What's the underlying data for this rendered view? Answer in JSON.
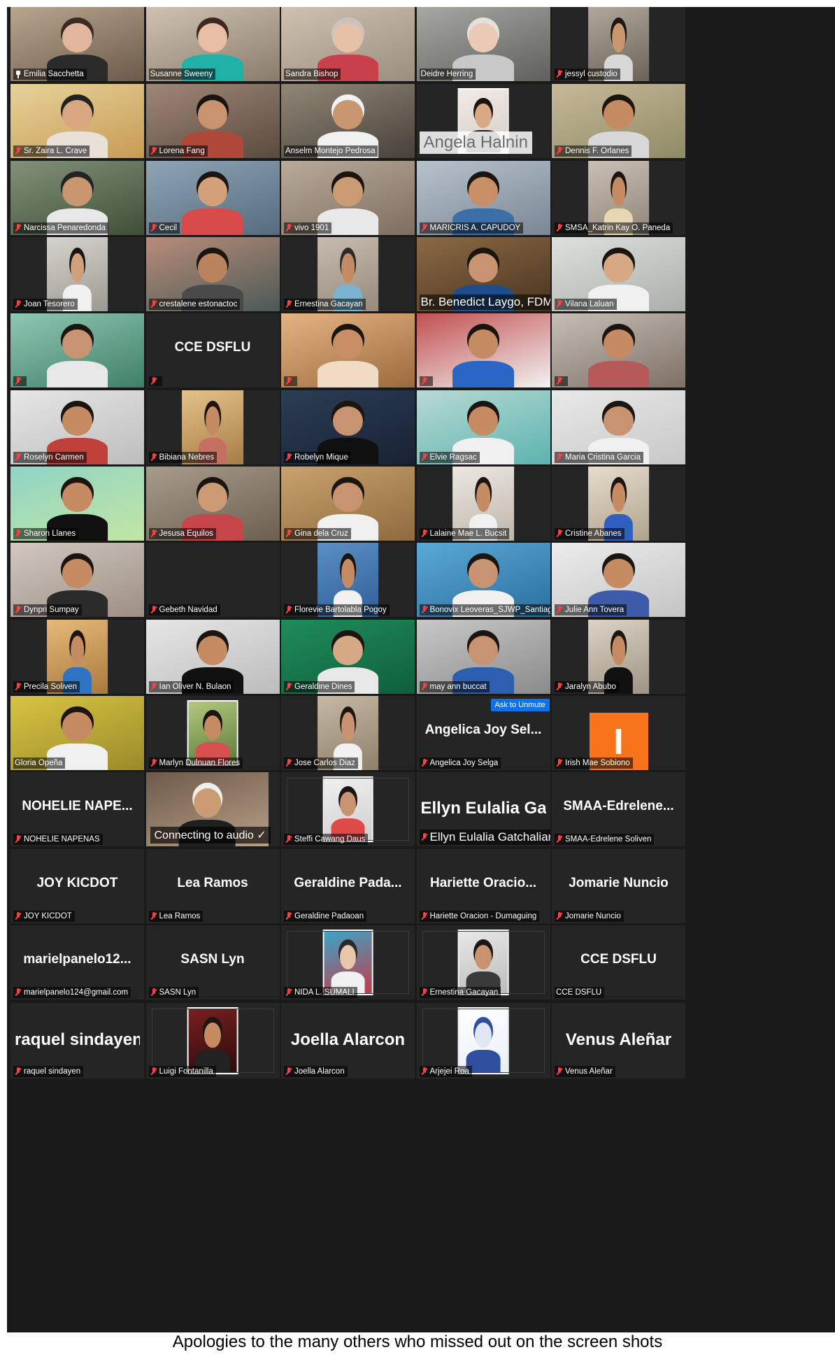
{
  "meeting": {
    "tiles": [
      {
        "name": "Emilia Sacchetta",
        "icon": "pin-icon",
        "muted": false,
        "type": "video",
        "bg": [
          "#b9a68f",
          "#6c5a4a"
        ],
        "skin": "#e1b69c",
        "hair": "#3a2a22",
        "shirt": "#2a2a2a"
      },
      {
        "name": "Susanne Sweeny",
        "muted": false,
        "active": true,
        "type": "video",
        "bg": [
          "#cfc2b0",
          "#8a7c6a"
        ],
        "skin": "#e7bda5",
        "hair": "#3c2a20",
        "shirt": "#1fb0a8"
      },
      {
        "name": "Sandra Bishop",
        "muted": false,
        "type": "video",
        "bg": [
          "#cfc1b0",
          "#9c8e7e"
        ],
        "skin": "#e7c0a8",
        "hair": "#c9c5bd",
        "shirt": "#c8404a"
      },
      {
        "name": "Deidre Herring",
        "muted": false,
        "type": "video",
        "bg": [
          "#a8a8a2",
          "#60605a"
        ],
        "skin": "#ecc9b4",
        "hair": "#e4e1da",
        "shirt": "#c8c8c8"
      },
      {
        "name": "jessyl custodio",
        "muted": true,
        "type": "video",
        "narrow": true,
        "bg": [
          "#b0a89a",
          "#6b6358"
        ],
        "skin": "#c9966e",
        "hair": "#1e1612",
        "shirt": "#d8d8d8"
      },
      {
        "name": "Sr. Zaira L. Crave",
        "muted": true,
        "type": "video",
        "bg": [
          "#e6d29a",
          "#c89b54"
        ],
        "skin": "#d9a67f",
        "hair": "#222222",
        "shirt": "#e9e1d8"
      },
      {
        "name": "Lorena Fang",
        "muted": true,
        "type": "video",
        "bg": [
          "#9f8777",
          "#5a4a3f"
        ],
        "skin": "#c99370",
        "hair": "#1a1410",
        "shirt": "#b0483a"
      },
      {
        "name": "Anselm Montejo Pedrosa",
        "muted": false,
        "type": "video",
        "bg": [
          "#928777",
          "#48413a"
        ],
        "skin": "#c9976f",
        "hair": "#f2f2f2",
        "shirt": "#f0f0f0"
      },
      {
        "name": "Angela Halnin",
        "muted": false,
        "type": "photo",
        "bg": [
          "#f1ebe6",
          "#d6ccc6"
        ],
        "skin": "#d8a985",
        "hair": "#1b1411",
        "shirt": "#1d1d1d"
      },
      {
        "name": "Dennis F. Orlanes",
        "muted": true,
        "type": "video",
        "bg": [
          "#c7b999",
          "#8f8a66"
        ],
        "skin": "#c58c63",
        "hair": "#1b1411",
        "shirt": "#d8d8d8"
      },
      {
        "name": "Narcissa Penaredonda",
        "muted": true,
        "type": "video",
        "bg": [
          "#83917a",
          "#3e4f38"
        ],
        "skin": "#c9976f",
        "hair": "#232323",
        "shirt": "#e8e8e8"
      },
      {
        "name": "Cecil",
        "muted": true,
        "type": "video",
        "bg": [
          "#8fa5b5",
          "#556c7c"
        ],
        "skin": "#d4a07a",
        "hair": "#1b1411",
        "shirt": "#d94a4a"
      },
      {
        "name": "vivo 1901",
        "muted": true,
        "type": "video",
        "bg": [
          "#b9ab9a",
          "#7d6e5e"
        ],
        "skin": "#cb9b74",
        "hair": "#1b1411",
        "shirt": "#e8e8e8"
      },
      {
        "name": "MARICRIS A. CAPUDOY",
        "muted": true,
        "type": "video",
        "bg": [
          "#b7c2cc",
          "#7a8794"
        ],
        "skin": "#c88e65",
        "hair": "#1b1411",
        "shirt": "#3c6fa8"
      },
      {
        "name": "SMSA_Katrin Kay O. Paneda",
        "muted": true,
        "type": "video",
        "narrow": true,
        "bg": [
          "#c9bfb2",
          "#90857a"
        ],
        "skin": "#c58c63",
        "hair": "#1b1411",
        "shirt": "#e8d7b3"
      },
      {
        "name": "Joan Tesorero",
        "muted": true,
        "type": "video",
        "narrow": true,
        "bg": [
          "#d6d3cd",
          "#9d9a95"
        ],
        "skin": "#d0a07c",
        "hair": "#1b1411",
        "shirt": "#f0f0f0"
      },
      {
        "name": "crestalene estonactoc",
        "muted": true,
        "type": "video",
        "bg": [
          "#b98c7a",
          "#4b5a56"
        ],
        "skin": "#b9845d",
        "hair": "#1b1411",
        "shirt": "#4a4a4a"
      },
      {
        "name": "Ernestina Gacayan",
        "muted": true,
        "type": "video",
        "narrow": true,
        "bg": [
          "#c7bcae",
          "#958a7c"
        ],
        "skin": "#c58c63",
        "hair": "#2b2b2b",
        "shirt": "#7bb3cf"
      },
      {
        "name": "Br. Benedict Laygo, FDM",
        "muted": false,
        "big_label": true,
        "type": "video",
        "bg": [
          "#8b6a44",
          "#4a3421"
        ],
        "skin": "#c89370",
        "hair": "#1b1411",
        "shirt": "#1f4c8a"
      },
      {
        "name": "Vilana Laluan",
        "muted": true,
        "type": "video",
        "bg": [
          "#dee0dd",
          "#a9b0a8"
        ],
        "skin": "#d6a883",
        "hair": "#1b1411",
        "shirt": "#f0f0f0"
      },
      {
        "name": "",
        "muted": true,
        "type": "video",
        "bg": [
          "#8fc8b4",
          "#3f7f68"
        ],
        "skin": "#c89370",
        "hair": "#1b1411",
        "shirt": "#e7e7e7"
      },
      {
        "name": "",
        "muted": true,
        "type": "text",
        "big": "CCE DSFLU"
      },
      {
        "name": "",
        "muted": true,
        "type": "video",
        "bg": [
          "#e6b482",
          "#9b6b3c"
        ],
        "skin": "#c88e65",
        "hair": "#1b1411",
        "shirt": "#f0dcc4"
      },
      {
        "name": "",
        "muted": true,
        "type": "video",
        "bg": [
          "#c24f4f",
          "#f2f2f2"
        ],
        "skin": "#c58c63",
        "hair": "#1b1411",
        "shirt": "#2a66c4"
      },
      {
        "name": "",
        "muted": true,
        "type": "video",
        "bg": [
          "#c6beb6",
          "#7e7066"
        ],
        "skin": "#c58c63",
        "hair": "#1b1411",
        "shirt": "#b55a59"
      },
      {
        "name": "Roselyn Carmen",
        "muted": true,
        "type": "video",
        "bg": [
          "#e6e6e6",
          "#bdbdbd"
        ],
        "skin": "#c58c63",
        "hair": "#1b1411",
        "shirt": "#c0403a"
      },
      {
        "name": "Bibiana Nebres",
        "muted": true,
        "type": "video",
        "narrow": true,
        "bg": [
          "#e4c28a",
          "#a77d44"
        ],
        "skin": "#c58c63",
        "hair": "#1b1411",
        "shirt": "#c56f62"
      },
      {
        "name": "Robelyn Mique",
        "muted": true,
        "type": "video",
        "bg": [
          "#2c3d55",
          "#182233"
        ],
        "skin": "#c89370",
        "hair": "#1b1411",
        "shirt": "#101010"
      },
      {
        "name": "Elvie Ragsac",
        "muted": true,
        "type": "video",
        "bg": [
          "#b9d9d3",
          "#5bb4b0"
        ],
        "skin": "#c58c63",
        "hair": "#1b1411",
        "shirt": "#f0f0f0"
      },
      {
        "name": "Maria Cristina Garcia",
        "muted": true,
        "type": "video",
        "bg": [
          "#e9e9e9",
          "#c7c7c7"
        ],
        "skin": "#c89370",
        "hair": "#1b1411",
        "shirt": "#f0f0f0"
      },
      {
        "name": "Sharon Llanes",
        "muted": true,
        "type": "video",
        "bg": [
          "#8fd4c6",
          "#c2e6a3"
        ],
        "skin": "#c58c63",
        "hair": "#1b1411",
        "shirt": "#101010"
      },
      {
        "name": "Jesusa Equilos",
        "muted": true,
        "type": "video",
        "bg": [
          "#a79b8c",
          "#6b604f"
        ],
        "skin": "#cb9b74",
        "hair": "#1b1411",
        "shirt": "#c64649"
      },
      {
        "name": "Gina dela Cruz",
        "muted": true,
        "type": "video",
        "bg": [
          "#c9a26d",
          "#8e6a3e"
        ],
        "skin": "#c89370",
        "hair": "#1b1411",
        "shirt": "#f0f0f0"
      },
      {
        "name": "Lalaine Mae L. Bucsit",
        "muted": true,
        "type": "video",
        "narrow": true,
        "bg": [
          "#ece8e1",
          "#bdb6ab"
        ],
        "skin": "#c58c63",
        "hair": "#1b1411",
        "shirt": "#f0f0f0"
      },
      {
        "name": "Cristine Abanes",
        "muted": true,
        "type": "video",
        "narrow": true,
        "bg": [
          "#e6dccb",
          "#b0a38d"
        ],
        "skin": "#c58c63",
        "hair": "#1b1411",
        "shirt": "#2f5fbf"
      },
      {
        "name": "Dynpri Sumpay",
        "muted": true,
        "type": "video",
        "bg": [
          "#d2c8bf",
          "#9c8f85"
        ],
        "skin": "#c58c63",
        "hair": "#1b1411",
        "shirt": "#2a2a2a"
      },
      {
        "name": "Gebeth Navidad",
        "muted": true,
        "type": "empty"
      },
      {
        "name": "Florevie Bartolabla Pogoy",
        "muted": true,
        "type": "video",
        "narrow": true,
        "bg": [
          "#5c8fc4",
          "#2e5e9a"
        ],
        "skin": "#c58c63",
        "hair": "#1b1411",
        "shirt": "#f0f0f0"
      },
      {
        "name": "Bonovix Leoveras_SJWP_Santiago...",
        "muted": true,
        "type": "video",
        "bg": [
          "#5aa9d6",
          "#2a6ea0"
        ],
        "skin": "#c89370",
        "hair": "#1b1411",
        "shirt": "#f0f0f0"
      },
      {
        "name": "Julie Ann Tovera",
        "muted": true,
        "type": "video",
        "bg": [
          "#ececec",
          "#c4c4c4"
        ],
        "skin": "#c58c63",
        "hair": "#1b1411",
        "shirt": "#3d5ba8"
      },
      {
        "name": "Precila Soliven",
        "muted": true,
        "type": "video",
        "narrow": true,
        "bg": [
          "#e6b97a",
          "#a87a3b"
        ],
        "skin": "#c58c63",
        "hair": "#1b1411",
        "shirt": "#2e73c4"
      },
      {
        "name": "Ian Oliver N. Bulaon",
        "muted": true,
        "type": "video",
        "bg": [
          "#e6e6e6",
          "#bcbcbc"
        ],
        "skin": "#c58c63",
        "hair": "#1b1411",
        "shirt": "#101010"
      },
      {
        "name": "Geraldine Dines",
        "muted": true,
        "type": "video",
        "bg": [
          "#1f8c5a",
          "#0f5f3c"
        ],
        "skin": "#d6a883",
        "hair": "#1b1411",
        "shirt": "#e8e8e8"
      },
      {
        "name": "may ann buccat",
        "muted": true,
        "type": "video",
        "bg": [
          "#c8c8c8",
          "#8a8a8a"
        ],
        "skin": "#c89370",
        "hair": "#1b1411",
        "shirt": "#2d5fb0"
      },
      {
        "name": "Jaralyn Abubo",
        "muted": true,
        "type": "video",
        "narrow": true,
        "bg": [
          "#dcd2c6",
          "#9f9383"
        ],
        "skin": "#c58c63",
        "hair": "#1b1411",
        "shirt": "#101010"
      },
      {
        "name": "Gloria Opeña",
        "muted": false,
        "type": "video",
        "bg": [
          "#d8c443",
          "#9a8b2a"
        ],
        "skin": "#c58c63",
        "hair": "#1b1411",
        "shirt": "#f0f0f0"
      },
      {
        "name": "Marlyn Dulnuan Flores",
        "muted": true,
        "type": "photo",
        "bg": [
          "#b3c97e",
          "#5b7a3a"
        ],
        "skin": "#c58c63",
        "hair": "#1b1411",
        "shirt": "#d84f4f"
      },
      {
        "name": "Jose Carlos Diaz",
        "muted": true,
        "type": "video",
        "narrow": true,
        "bg": [
          "#c6b9a3",
          "#8e806a"
        ],
        "skin": "#c89370",
        "hair": "#1b1411",
        "shirt": "#f0f0f0"
      },
      {
        "name": "Angelica Joy Selga",
        "muted": true,
        "type": "text",
        "big": "Angelica Joy Sel...",
        "overlay": {
          "unmute": "Ask to Unmute",
          "more": "···"
        }
      },
      {
        "name": "Irish Mae Sobiono",
        "muted": true,
        "type": "avatar",
        "letter": "I"
      },
      {
        "name": "NOHELIE NAPENAS",
        "muted": true,
        "type": "text",
        "big": "NOHELIE NAPE..."
      },
      {
        "name": "",
        "muted": false,
        "type": "connecting",
        "status": "Connecting to audio ✓",
        "bg": [
          "#6c5a4a",
          "#b89f86"
        ],
        "skin": "#cb9b74",
        "hair": "#eeeeee",
        "shirt": "#202020"
      },
      {
        "name": "Steffi Cawang Daus",
        "muted": true,
        "type": "photo",
        "bg": [
          "#f0f0f0",
          "#cfcfcf"
        ],
        "skin": "#c89370",
        "hair": "#1b1411",
        "shirt": "#e04a4a"
      },
      {
        "name": "Ellyn Eulalia Gatchalian",
        "muted": true,
        "big_label": true,
        "type": "text",
        "big": "Ellyn Eulalia Gat...",
        "lg": true
      },
      {
        "name": "SMAA-Edrelene Soliven",
        "muted": true,
        "type": "text",
        "big": "SMAA-Edrelene..."
      },
      {
        "name": "JOY KICDOT",
        "muted": true,
        "type": "text",
        "big": "JOY KICDOT"
      },
      {
        "name": "Lea Ramos",
        "muted": true,
        "type": "text",
        "big": "Lea Ramos"
      },
      {
        "name": "Geraldine Padaoan",
        "muted": true,
        "type": "text",
        "big": "Geraldine Pada..."
      },
      {
        "name": "Hariette Oracion - Dumaguing",
        "muted": true,
        "type": "text",
        "big": "Hariette Oracio..."
      },
      {
        "name": "Jomarie Nuncio",
        "muted": true,
        "type": "text",
        "big": "Jomarie Nuncio"
      },
      {
        "name": "marielpanelo124@gmail.com",
        "muted": true,
        "type": "text",
        "big": "marielpanelo12..."
      },
      {
        "name": "SASN Lyn",
        "muted": true,
        "type": "text",
        "big": "SASN Lyn"
      },
      {
        "name": "NIDA L. SUMALI",
        "muted": true,
        "type": "photo",
        "bg": [
          "#3aa6c9",
          "#c43a4a"
        ],
        "skin": "#e8c7a8",
        "hair": "#2a2a2a",
        "shirt": "#f0f0f0"
      },
      {
        "name": "Ernestina Gacayan",
        "muted": true,
        "type": "photo",
        "bg": [
          "#e8e8e8",
          "#bcbcbc"
        ],
        "skin": "#c89370",
        "hair": "#1b1411",
        "shirt": "#3a3a3a"
      },
      {
        "name": "CCE DSFLU",
        "muted": false,
        "type": "text",
        "big": "CCE DSFLU"
      },
      {
        "name": "raquel sindayen",
        "muted": true,
        "type": "text",
        "big": "raquel sindayen",
        "lg": true
      },
      {
        "name": "Luigi Fontanilla",
        "muted": true,
        "type": "photo",
        "bg": [
          "#7a1f1f",
          "#2a0c0c"
        ],
        "skin": "#c58c63",
        "hair": "#1b1411",
        "shirt": "#222222"
      },
      {
        "name": "Joella Alarcon",
        "muted": true,
        "type": "text",
        "big": "Joella Alarcon",
        "lg": true
      },
      {
        "name": "Arjejei Roa",
        "muted": true,
        "type": "photo",
        "bg": [
          "#ffffff",
          "#e9eef8"
        ],
        "skin": "#e0e6f2",
        "hair": "#2f4f9e",
        "shirt": "#2f4f9e"
      },
      {
        "name": "Venus Aleñar",
        "muted": true,
        "type": "text",
        "big": "Venus Aleñar",
        "lg": true
      }
    ]
  },
  "caption": "Apologies to the many others who missed out on the screen shots"
}
